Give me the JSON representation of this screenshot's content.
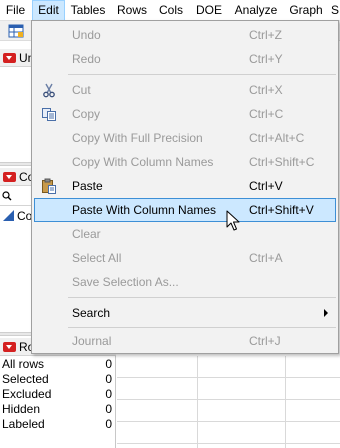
{
  "menubar": {
    "items": [
      "File",
      "Edit",
      "Tables",
      "Rows",
      "Cols",
      "DOE",
      "Analyze",
      "Graph",
      "S"
    ],
    "active": "Edit"
  },
  "left_panels": {
    "section1_label": "Un",
    "section2_label": "Co",
    "section2_row": "Co",
    "section3_label": "Ro"
  },
  "rows_panel": {
    "rows": [
      {
        "label": "All rows",
        "value": "0"
      },
      {
        "label": "Selected",
        "value": "0"
      },
      {
        "label": "Excluded",
        "value": "0"
      },
      {
        "label": "Hidden",
        "value": "0"
      },
      {
        "label": "Labeled",
        "value": "0"
      }
    ]
  },
  "edit_menu": {
    "items": [
      {
        "label": "Undo",
        "shortcut": "Ctrl+Z",
        "enabled": false,
        "icon": ""
      },
      {
        "label": "Redo",
        "shortcut": "Ctrl+Y",
        "enabled": false,
        "icon": ""
      },
      {
        "label": "Cut",
        "shortcut": "Ctrl+X",
        "enabled": false,
        "icon": "scissors-icon"
      },
      {
        "label": "Copy",
        "shortcut": "Ctrl+C",
        "enabled": false,
        "icon": "copy-icon"
      },
      {
        "label": "Copy With Full Precision",
        "shortcut": "Ctrl+Alt+C",
        "enabled": false,
        "icon": ""
      },
      {
        "label": "Copy With Column Names",
        "shortcut": "Ctrl+Shift+C",
        "enabled": false,
        "icon": ""
      },
      {
        "label": "Paste",
        "shortcut": "Ctrl+V",
        "enabled": true,
        "icon": "paste-icon"
      },
      {
        "label": "Paste With Column Names",
        "shortcut": "Ctrl+Shift+V",
        "enabled": true,
        "hover": true,
        "icon": ""
      },
      {
        "label": "Clear",
        "shortcut": "",
        "enabled": false,
        "icon": ""
      },
      {
        "label": "Select All",
        "shortcut": "Ctrl+A",
        "enabled": false,
        "icon": ""
      },
      {
        "label": "Save Selection As...",
        "shortcut": "",
        "enabled": false,
        "icon": ""
      },
      {
        "label": "Search",
        "shortcut": "",
        "enabled": true,
        "submenu": true,
        "icon": ""
      },
      {
        "label": "Journal",
        "shortcut": "Ctrl+J",
        "enabled": false,
        "icon": ""
      }
    ]
  },
  "colors": {
    "hover_bg": "#cce8ff",
    "hover_border": "#3d8fd6",
    "disabled_text": "#9a9a9a",
    "red_triangle": "#d42020"
  }
}
